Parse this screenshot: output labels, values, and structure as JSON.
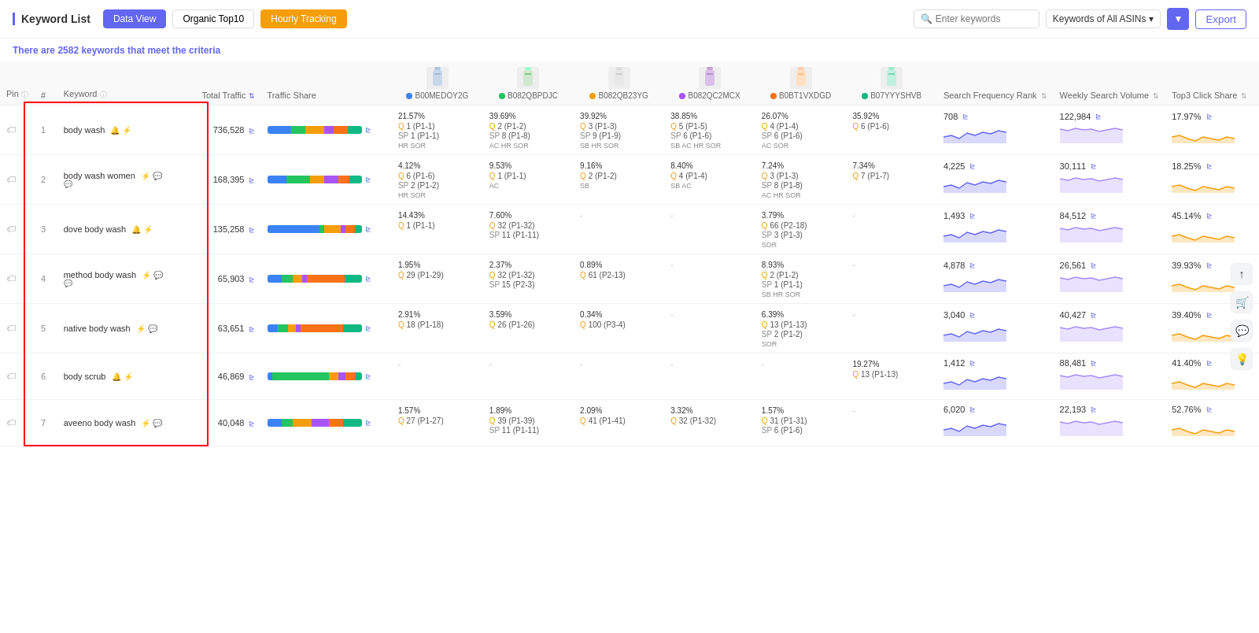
{
  "header": {
    "title": "Keyword List",
    "tabs": [
      {
        "label": "Data View",
        "active": true
      },
      {
        "label": "Organic Top10",
        "active": false
      },
      {
        "label": "Hourly Tracking",
        "active": false,
        "special": "yellow"
      }
    ],
    "search_placeholder": "Enter keywords",
    "filter_label": "Keywords of All ASINs",
    "export_label": "Export"
  },
  "criteria": {
    "prefix": "There are ",
    "count": "2582",
    "suffix": " keywords that meet the criteria"
  },
  "columns": {
    "pin": "Pin",
    "num": "#",
    "keyword": "Keyword",
    "total_traffic": "Total Traffic",
    "traffic_share": "Traffic Share",
    "sfr": "Search Frequency Rank",
    "wsv": "Weekly Search Volume",
    "tcs": "Top3 Click Share"
  },
  "products": [
    {
      "id": "B00MEDOY2G",
      "color": "#3b82f6"
    },
    {
      "id": "B082QBPDJC",
      "color": "#22c55e"
    },
    {
      "id": "B082QB23YG",
      "color": "#f59e0b"
    },
    {
      "id": "B082QC2MCX",
      "color": "#a855f7"
    },
    {
      "id": "B0BT1VXDGD",
      "color": "#f97316"
    },
    {
      "id": "B07YYYSHVB",
      "color": "#10b981"
    }
  ],
  "rows": [
    {
      "pin": false,
      "num": 1,
      "keyword": "body wash",
      "icons": [
        "🔔",
        "⚡"
      ],
      "total_traffic": "736,528",
      "traffic_bar": [
        {
          "color": "#3b82f6",
          "pct": 25
        },
        {
          "color": "#22c55e",
          "pct": 15
        },
        {
          "color": "#f59e0b",
          "pct": 20
        },
        {
          "color": "#a855f7",
          "pct": 10
        },
        {
          "color": "#f97316",
          "pct": 15
        },
        {
          "color": "#10b981",
          "pct": 15
        }
      ],
      "products": [
        {
          "pct": "21.57%",
          "q": "1 (P1-1)",
          "sp": "1 (P1-1)",
          "badges": "HR SOR"
        },
        {
          "pct": "39.69%",
          "q": "2 (P1-2)",
          "sp": "8 (P1-8)",
          "badges": "AC HR SOR"
        },
        {
          "pct": "39.92%",
          "q": "3 (P1-3)",
          "sp": "9 (P1-9)",
          "badges": "SB HR SOR"
        },
        {
          "pct": "38.85%",
          "q": "5 (P1-5)",
          "sp": "6 (P1-6)",
          "badges": "SB AC HR SOR"
        },
        {
          "pct": "26.07%",
          "q": "4 (P1-4)",
          "sp": "6 (P1-6)",
          "badges": "AC SOR"
        },
        {
          "pct": "35.92%",
          "q": "6 (P1-6)",
          "sp": "",
          "badges": ""
        }
      ],
      "sfr": "708",
      "wsv": "122,984",
      "tcs": "17.97%"
    },
    {
      "pin": false,
      "num": 2,
      "keyword": "body wash women",
      "icons": [
        "⚡",
        "💬"
      ],
      "total_traffic": "168,395",
      "traffic_bar": [
        {
          "color": "#3b82f6",
          "pct": 20
        },
        {
          "color": "#22c55e",
          "pct": 25
        },
        {
          "color": "#f59e0b",
          "pct": 15
        },
        {
          "color": "#a855f7",
          "pct": 15
        },
        {
          "color": "#f97316",
          "pct": 12
        },
        {
          "color": "#10b981",
          "pct": 13
        }
      ],
      "products": [
        {
          "pct": "4.12%",
          "q": "6 (P1-6)",
          "sp": "2 (P1-2)",
          "badges": "HR SOR"
        },
        {
          "pct": "9.53%",
          "q": "1 (P1-1)",
          "sp": "",
          "badges": "AC"
        },
        {
          "pct": "9.16%",
          "q": "2 (P1-2)",
          "sp": "",
          "badges": "SB"
        },
        {
          "pct": "8.40%",
          "q": "4 (P1-4)",
          "sp": "",
          "badges": "SB AC"
        },
        {
          "pct": "7.24%",
          "q": "3 (P1-3)",
          "sp": "8 (P1-8)",
          "badges": "AC HR SOR"
        },
        {
          "pct": "7.34%",
          "q": "7 (P1-7)",
          "sp": "",
          "badges": ""
        }
      ],
      "sfr": "4,225",
      "wsv": "30,111",
      "tcs": "18.25%"
    },
    {
      "pin": false,
      "num": 3,
      "keyword": "dove body wash",
      "icons": [
        "🔔",
        "⚡"
      ],
      "total_traffic": "135,258",
      "traffic_bar": [
        {
          "color": "#3b82f6",
          "pct": 55
        },
        {
          "color": "#22c55e",
          "pct": 5
        },
        {
          "color": "#f59e0b",
          "pct": 18
        },
        {
          "color": "#a855f7",
          "pct": 5
        },
        {
          "color": "#f97316",
          "pct": 10
        },
        {
          "color": "#10b981",
          "pct": 7
        }
      ],
      "products": [
        {
          "pct": "14.43%",
          "q": "1 (P1-1)",
          "sp": "",
          "badges": ""
        },
        {
          "pct": "7.60%",
          "q": "32 (P1-32)",
          "sp": "11 (P1-11)",
          "badges": ""
        },
        {
          "pct": "-",
          "q": "",
          "sp": "",
          "badges": ""
        },
        {
          "pct": "-",
          "q": "",
          "sp": "",
          "badges": ""
        },
        {
          "pct": "3.79%",
          "q": "66 (P2-18)",
          "sp": "3 (P1-3)",
          "badges": "SOR"
        },
        {
          "pct": "-",
          "q": "",
          "sp": "",
          "badges": ""
        }
      ],
      "sfr": "1,493",
      "wsv": "84,512",
      "tcs": "45.14%"
    },
    {
      "pin": false,
      "num": 4,
      "keyword": "method body wash",
      "icons": [
        "⚡",
        "💬"
      ],
      "total_traffic": "65,903",
      "traffic_bar": [
        {
          "color": "#3b82f6",
          "pct": 15
        },
        {
          "color": "#22c55e",
          "pct": 12
        },
        {
          "color": "#f59e0b",
          "pct": 10
        },
        {
          "color": "#a855f7",
          "pct": 5
        },
        {
          "color": "#f97316",
          "pct": 40
        },
        {
          "color": "#10b981",
          "pct": 18
        }
      ],
      "products": [
        {
          "pct": "1.95%",
          "q": "29 (P1-29)",
          "sp": "",
          "badges": ""
        },
        {
          "pct": "2.37%",
          "q": "32 (P1-32)",
          "sp": "15 (P2-3)",
          "badges": ""
        },
        {
          "pct": "0.89%",
          "q": "61 (P2-13)",
          "sp": "",
          "badges": ""
        },
        {
          "pct": "-",
          "q": "",
          "sp": "",
          "badges": ""
        },
        {
          "pct": "8.93%",
          "q": "2 (P1-2)",
          "sp": "1 (P1-1)",
          "badges": "SB HR SOR"
        },
        {
          "pct": "-",
          "q": "",
          "sp": "",
          "badges": ""
        }
      ],
      "sfr": "4,878",
      "wsv": "26,561",
      "tcs": "39.93%"
    },
    {
      "pin": false,
      "num": 5,
      "keyword": "native body wash",
      "icons": [
        "⚡",
        "💬"
      ],
      "total_traffic": "63,651",
      "traffic_bar": [
        {
          "color": "#3b82f6",
          "pct": 10
        },
        {
          "color": "#22c55e",
          "pct": 12
        },
        {
          "color": "#f59e0b",
          "pct": 8
        },
        {
          "color": "#a855f7",
          "pct": 5
        },
        {
          "color": "#f97316",
          "pct": 45
        },
        {
          "color": "#10b981",
          "pct": 20
        }
      ],
      "products": [
        {
          "pct": "2.91%",
          "q": "18 (P1-18)",
          "sp": "",
          "badges": ""
        },
        {
          "pct": "3.59%",
          "q": "26 (P1-26)",
          "sp": "",
          "badges": ""
        },
        {
          "pct": "0.34%",
          "q": "100 (P3-4)",
          "sp": "",
          "badges": ""
        },
        {
          "pct": "-",
          "q": "",
          "sp": "",
          "badges": ""
        },
        {
          "pct": "6.39%",
          "q": "13 (P1-13)",
          "sp": "2 (P1-2)",
          "badges": "SOR"
        },
        {
          "pct": "-",
          "q": "",
          "sp": "",
          "badges": ""
        }
      ],
      "sfr": "3,040",
      "wsv": "40,427",
      "tcs": "39.40%"
    },
    {
      "pin": false,
      "num": 6,
      "keyword": "body scrub",
      "icons": [
        "🔔",
        "⚡"
      ],
      "total_traffic": "46,869",
      "traffic_bar": [
        {
          "color": "#3b82f6",
          "pct": 5
        },
        {
          "color": "#22c55e",
          "pct": 60
        },
        {
          "color": "#f59e0b",
          "pct": 10
        },
        {
          "color": "#a855f7",
          "pct": 8
        },
        {
          "color": "#f97316",
          "pct": 10
        },
        {
          "color": "#10b981",
          "pct": 7
        }
      ],
      "products": [
        {
          "pct": "-",
          "q": "",
          "sp": "",
          "badges": ""
        },
        {
          "pct": "-",
          "q": "",
          "sp": "",
          "badges": ""
        },
        {
          "pct": "-",
          "q": "",
          "sp": "",
          "badges": ""
        },
        {
          "pct": "-",
          "q": "",
          "sp": "",
          "badges": ""
        },
        {
          "pct": "-",
          "q": "",
          "sp": "",
          "badges": ""
        },
        {
          "pct": "19.27%",
          "q": "13 (P1-13)",
          "sp": "",
          "badges": ""
        }
      ],
      "sfr": "1,412",
      "wsv": "88,481",
      "tcs": "41.40%"
    },
    {
      "pin": false,
      "num": 7,
      "keyword": "aveeno body wash",
      "icons": [
        "⚡",
        "💬"
      ],
      "total_traffic": "40,048",
      "traffic_bar": [
        {
          "color": "#3b82f6",
          "pct": 15
        },
        {
          "color": "#22c55e",
          "pct": 12
        },
        {
          "color": "#f59e0b",
          "pct": 20
        },
        {
          "color": "#a855f7",
          "pct": 18
        },
        {
          "color": "#f97316",
          "pct": 15
        },
        {
          "color": "#10b981",
          "pct": 20
        }
      ],
      "products": [
        {
          "pct": "1.57%",
          "q": "27 (P1-27)",
          "sp": "",
          "badges": ""
        },
        {
          "pct": "1.89%",
          "q": "39 (P1-39)",
          "sp": "11 (P1-11)",
          "badges": ""
        },
        {
          "pct": "2.09%",
          "q": "41 (P1-41)",
          "sp": "",
          "badges": ""
        },
        {
          "pct": "3.32%",
          "q": "32 (P1-32)",
          "sp": "",
          "badges": ""
        },
        {
          "pct": "1.57%",
          "q": "31 (P1-31)",
          "sp": "6 (P1-6)",
          "badges": ""
        },
        {
          "pct": "-",
          "q": "",
          "sp": "",
          "badges": ""
        }
      ],
      "sfr": "6,020",
      "wsv": "22,193",
      "tcs": "52.76%"
    }
  ]
}
